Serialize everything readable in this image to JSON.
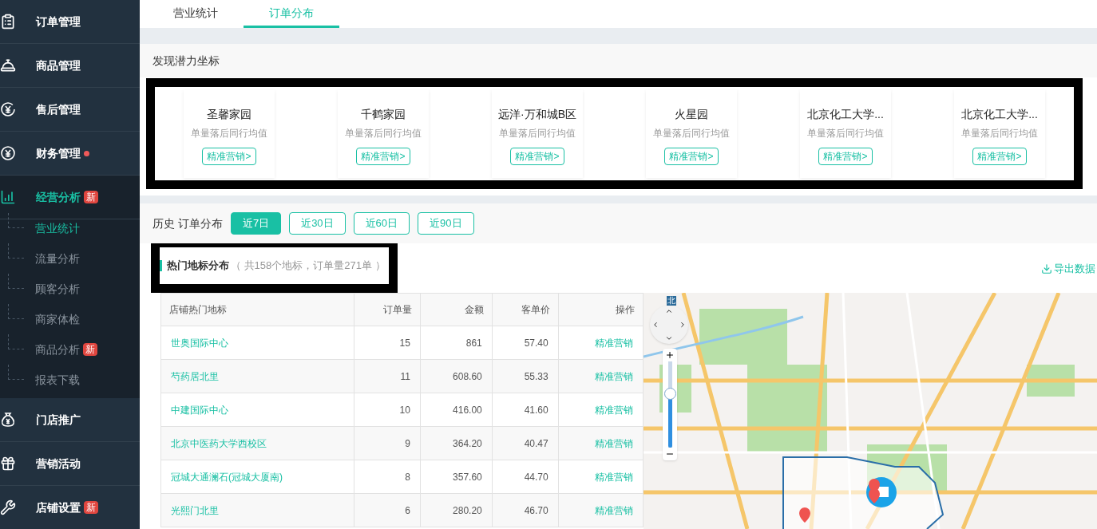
{
  "sidebar": {
    "items": [
      {
        "label": "订单管理",
        "selected": false,
        "alert": false
      },
      {
        "label": "商品管理",
        "selected": false,
        "alert": false
      },
      {
        "label": "售后管理",
        "selected": false,
        "alert": false
      },
      {
        "label": "财务管理",
        "selected": false,
        "alert": true
      },
      {
        "label": "经营分析",
        "selected": true,
        "alert": false,
        "badge": "新",
        "expanded": true,
        "children": [
          {
            "label": "营业统计",
            "selected": true
          },
          {
            "label": "流量分析",
            "selected": false
          },
          {
            "label": "顾客分析",
            "selected": false
          },
          {
            "label": "商家体检",
            "selected": false
          },
          {
            "label": "商品分析",
            "selected": false,
            "badge": "新"
          },
          {
            "label": "报表下载",
            "selected": false
          }
        ]
      },
      {
        "label": "门店推广",
        "selected": false,
        "alert": false
      },
      {
        "label": "营销活动",
        "selected": false,
        "alert": false
      },
      {
        "label": "店铺设置",
        "selected": false,
        "alert": false,
        "badge": "新"
      }
    ]
  },
  "tabs": [
    {
      "label": "营业统计",
      "selected": false
    },
    {
      "label": "订单分布",
      "selected": true
    }
  ],
  "potential": {
    "title": "发现潜力坐标",
    "cards": [
      {
        "name": "圣馨家园",
        "note": "单量落后同行均值",
        "action": "精准营销>"
      },
      {
        "name": "千鹤家园",
        "note": "单量落后同行均值",
        "action": "精准营销>"
      },
      {
        "name": "远洋·万和城B区",
        "note": "单量落后同行均值",
        "action": "精准营销>"
      },
      {
        "name": "火星园",
        "note": "单量落后同行均值",
        "action": "精准营销>"
      },
      {
        "name": "北京化工大学...",
        "note": "单量落后同行均值",
        "action": "精准营销>"
      },
      {
        "name": "北京化工大学...",
        "note": "单量落后同行均值",
        "action": "精准营销>"
      }
    ]
  },
  "history": {
    "label": "历史 订单分布",
    "periods": [
      {
        "label": "近7日",
        "selected": true
      },
      {
        "label": "近30日",
        "selected": false
      },
      {
        "label": "近60日",
        "selected": false
      },
      {
        "label": "近90日",
        "selected": false
      }
    ]
  },
  "hot": {
    "title": "热门地标分布",
    "summary": "（ 共158个地标，订单量271单 ）",
    "export": "导出数据"
  },
  "table": {
    "columns": [
      "店铺热门地标",
      "订单量",
      "金额",
      "客单价",
      "操作"
    ],
    "rows": [
      [
        "世奥国际中心",
        "15",
        "861",
        "57.40",
        "精准营销"
      ],
      [
        "芍药居北里",
        "11",
        "608.60",
        "55.33",
        "精准营销"
      ],
      [
        "中建国际中心",
        "10",
        "416.00",
        "41.60",
        "精准营销"
      ],
      [
        "北京中医药大学西校区",
        "9",
        "364.20",
        "40.47",
        "精准营销"
      ],
      [
        "冠城大通澜石(冠城大厦南)",
        "8",
        "357.60",
        "44.70",
        "精准营销"
      ],
      [
        "光熙门北里",
        "6",
        "280.20",
        "46.70",
        "精准营销"
      ]
    ]
  },
  "map": {
    "compass": "北",
    "zoom": {
      "level": 0.62
    }
  }
}
